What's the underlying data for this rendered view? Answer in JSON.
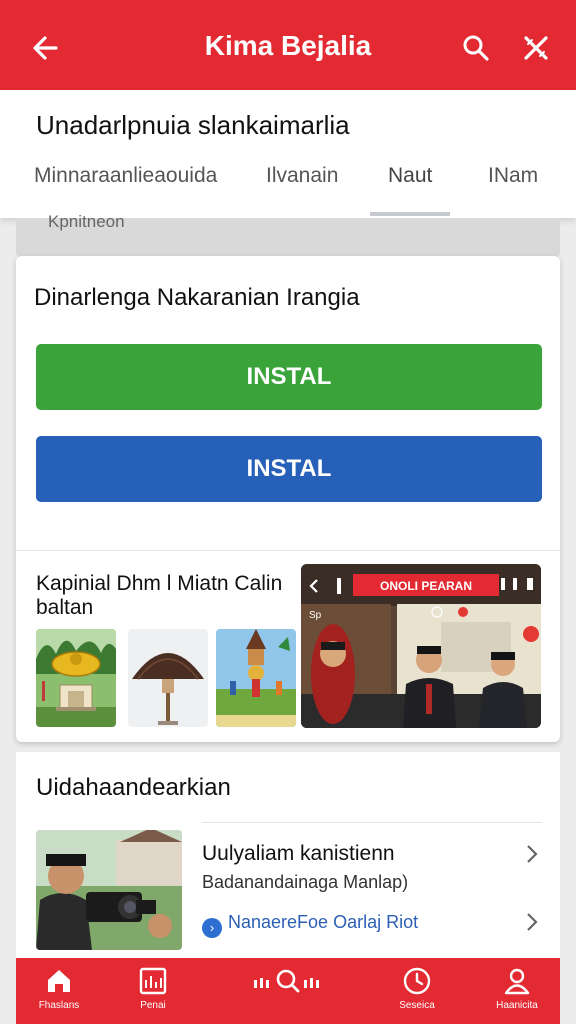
{
  "topbar": {
    "title": "Kima Bejalia",
    "back_icon": "arrow-left-icon",
    "search_icon": "search-icon",
    "close_icon": "close-icon"
  },
  "header": {
    "subtitle": "Unadarlpnuia slankaimarlia",
    "tabs": [
      "Minnaraanlieaouida",
      "Ilvanain",
      "Naut",
      "INam"
    ],
    "active_tab": "Naut"
  },
  "strip": {
    "label": "Kpnitneon"
  },
  "card": {
    "heading": "Dinarlenga Nakaranian Irangia",
    "install_green": "INSTAL",
    "install_blue": "INSTAL",
    "promo_text": "Kapinial Dhm l Miatn Calin baltan",
    "video_banner": "ONOLI PEARAN",
    "video_sub": "Sp"
  },
  "section": {
    "title": "Uidahaandearkian",
    "article": {
      "title": "Uulyaliam kanistienn",
      "subtitle": "Badanandainaga Manlap)",
      "link": "NanaereFoe Oarlaj Riot"
    }
  },
  "bottom_nav": [
    {
      "label": "Fhaslans",
      "icon": "home-icon"
    },
    {
      "label": "Penai",
      "icon": "chart-icon"
    },
    {
      "label": "",
      "icon": "search-icon"
    },
    {
      "label": "Seseica",
      "icon": "clock-icon"
    },
    {
      "label": "Haanicita",
      "icon": "user-icon"
    }
  ],
  "colors": {
    "brand_red": "#e32a33",
    "install_green": "#3aa43a",
    "install_blue": "#2660b8",
    "link_blue": "#2c5fb5"
  }
}
